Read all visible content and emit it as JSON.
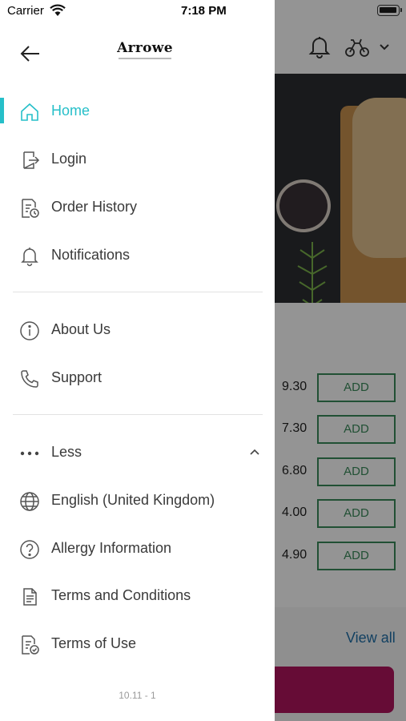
{
  "status_bar": {
    "carrier": "Carrier",
    "time": "7:18 PM"
  },
  "header": {
    "logo_text": "Arrowe"
  },
  "menu": {
    "primary": [
      {
        "label": "Home",
        "icon": "home-icon",
        "active": true
      },
      {
        "label": "Login",
        "icon": "login-icon"
      },
      {
        "label": "Order History",
        "icon": "order-history-icon"
      },
      {
        "label": "Notifications",
        "icon": "bell-icon"
      }
    ],
    "secondary": [
      {
        "label": "About Us",
        "icon": "info-icon"
      },
      {
        "label": "Support",
        "icon": "phone-icon"
      }
    ],
    "more_toggle": {
      "label": "Less",
      "icon": "more-dots-icon",
      "expanded": true
    },
    "tertiary": [
      {
        "label": "English (United Kingdom)",
        "icon": "globe-icon"
      },
      {
        "label": "Allergy Information",
        "icon": "question-icon"
      },
      {
        "label": "Terms and Conditions",
        "icon": "document-icon"
      },
      {
        "label": "Terms of Use",
        "icon": "document-check-icon"
      }
    ]
  },
  "version": "10.11 - 1",
  "background": {
    "prices": [
      "9.30",
      "7.30",
      "6.80",
      "4.00",
      "4.90"
    ],
    "add_label": "ADD",
    "view_all": "View all"
  },
  "colors": {
    "accent": "#26bfc9",
    "add_button": "#3a8a5b",
    "cta": "#b0155e",
    "link": "#1f6fa8"
  }
}
